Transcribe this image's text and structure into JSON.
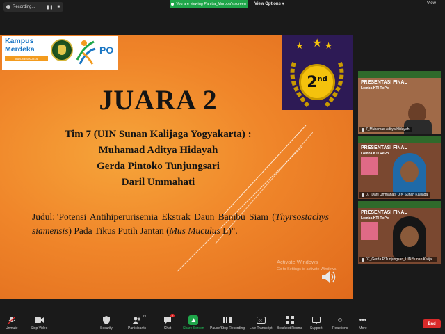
{
  "top_bar": {
    "recording_label": "Recording...",
    "pause_icon": "pause-icon",
    "stop_icon": "stop-icon",
    "viewing_label": "You are viewing Panitia_Muroba's screen",
    "view_options_label": "View Options",
    "view_label": "View"
  },
  "slide": {
    "logo_line1": "Kampus",
    "logo_line2": "Merdeka",
    "logo_tag": "INDONESIA JAYA",
    "logo_po": "PO",
    "medal_rank": "2",
    "medal_suffix": "nd",
    "title": "JUARA 2",
    "team_line": "Tim 7 (UIN Sunan Kalijaga Yogyakarta) :",
    "members": [
      "Muhamad Aditya Hidayah",
      "Gerda Pintoko Tunjungsari",
      "Daril Ummahati"
    ],
    "judul_prefix": "Judul:\"Potensi Antihiperurisemia Ekstrak Daun Bambu Siam (",
    "judul_italic1": "Thyrsostachys siamensis",
    "judul_mid": ") Pada Tikus Putih Jantan (",
    "judul_italic2": "Mus Muculus",
    "judul_suffix": " L)\".",
    "watermark_title": "Activate Windows",
    "watermark_sub": "Go to Settings to activate Windows."
  },
  "participants": [
    {
      "title": "PRESENTASI FINAL",
      "sub": "Lomba KTI RePo",
      "name": "7_Muhamad Aditya Hidayah"
    },
    {
      "title": "PRESENTASI FINAL",
      "sub": "Lomba KTI RePo",
      "name": "07_Daril Ummahati_UIN Sunan Kalijaga"
    },
    {
      "title": "PRESENTASI FINAL",
      "sub": "Lomba KTI RePo",
      "name": "07_Gerda P Tunjungsari_UIN Sunan Kalija..."
    }
  ],
  "toolbar": {
    "unmute": "Unmute",
    "stop_video": "Stop Video",
    "security": "Security",
    "participants": "Participants",
    "participants_count": "23",
    "chat": "Chat",
    "chat_badge": "2",
    "share_screen": "Share Screen",
    "pause_stop_recording": "Pause/Stop Recording",
    "live_transcript": "Live Transcript",
    "breakout_rooms": "Breakout Rooms",
    "support": "Support",
    "reactions": "Reactions",
    "more": "More",
    "end": "End"
  },
  "colors": {
    "share_green": "#1fa64a",
    "end_red": "#d92a2a",
    "slide_orange": "#f0862a",
    "medal_gold": "#f4c20d"
  }
}
